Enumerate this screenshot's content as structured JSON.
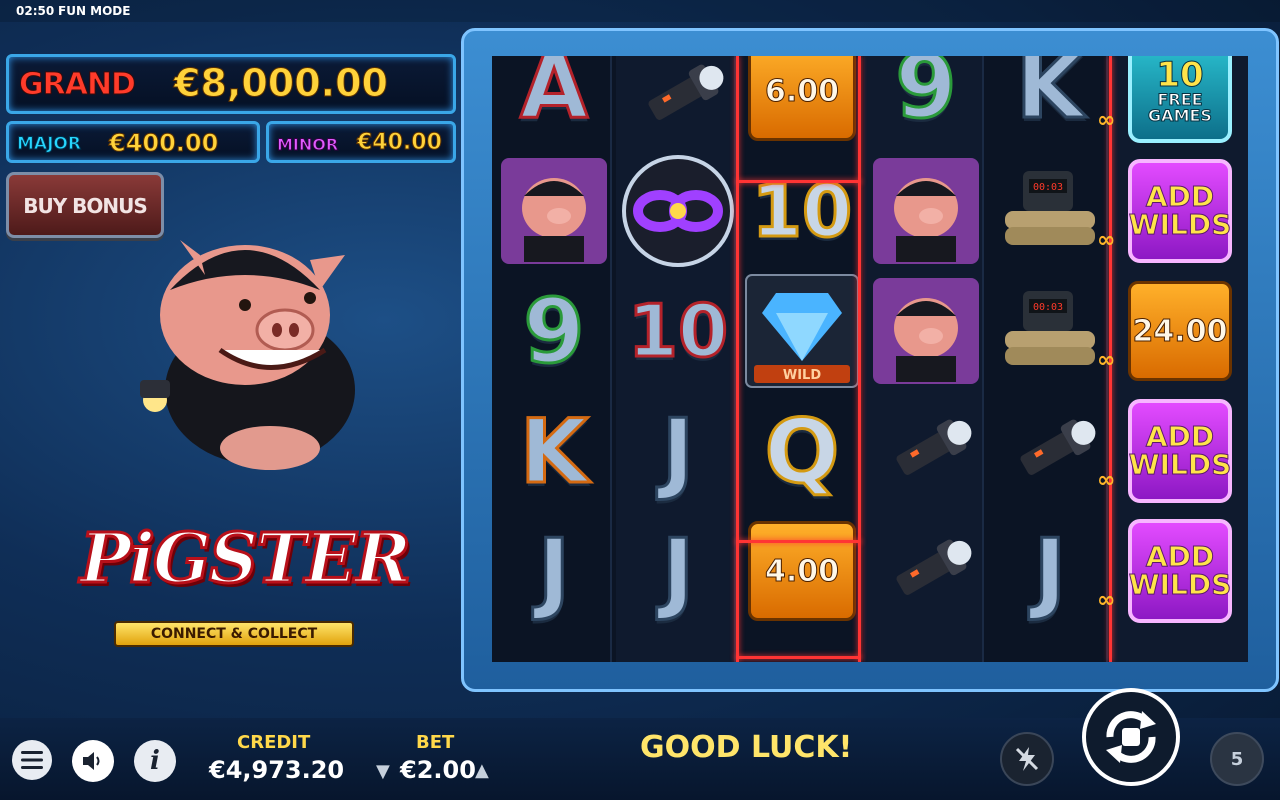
{
  "status_bar": {
    "time": "02:50",
    "mode": "FUN MODE"
  },
  "jackpots": {
    "grand": {
      "label": "GRAND",
      "value": "€8,000.00"
    },
    "major": {
      "label": "MAJOR",
      "value": "€400.00"
    },
    "minor": {
      "label": "MINOR",
      "value": "€40.00"
    }
  },
  "buy_bonus": {
    "label": "BUY BONUS"
  },
  "logo": {
    "title": "PiGSTER",
    "tagline": "CONNECT & COLLECT"
  },
  "reels": {
    "columns": [
      [
        "A",
        "pig",
        "9",
        "K",
        "J"
      ],
      [
        "flashlight",
        "connect-collect",
        "10",
        "J",
        "J"
      ],
      [
        "6.00",
        "10",
        "diamond-wild",
        "Q",
        "4.00"
      ],
      [
        "9",
        "pig",
        "pig",
        "flashlight",
        "flashlight"
      ],
      [
        "K",
        "bomb",
        "bomb",
        "flashlight",
        "J"
      ],
      [
        "10 FREE GAMES",
        "ADD WILDS",
        "24.00",
        "ADD WILDS",
        "ADD WILDS"
      ]
    ],
    "coin_values": {
      "c3r1": "6.00",
      "c3r5": "4.00",
      "c6r3": "24.00"
    },
    "free_games": {
      "count": "10",
      "text": "FREE GAMES"
    },
    "add_wilds": "ADD WILDS",
    "connect_collect_label": "CONNECT & COLLECT",
    "wild_label": "WILD"
  },
  "bottom_bar": {
    "credit_label": "CREDIT",
    "credit_value": "€4,973.20",
    "bet_label": "BET",
    "bet_value": "€2.00",
    "message": "GOOD LUCK!",
    "autoplay_count": "5"
  },
  "colors": {
    "accent_gold": "#ffd84a",
    "grand_red": "#ff3b2a",
    "major_cyan": "#27d7ff",
    "minor_magenta": "#e05cff"
  }
}
